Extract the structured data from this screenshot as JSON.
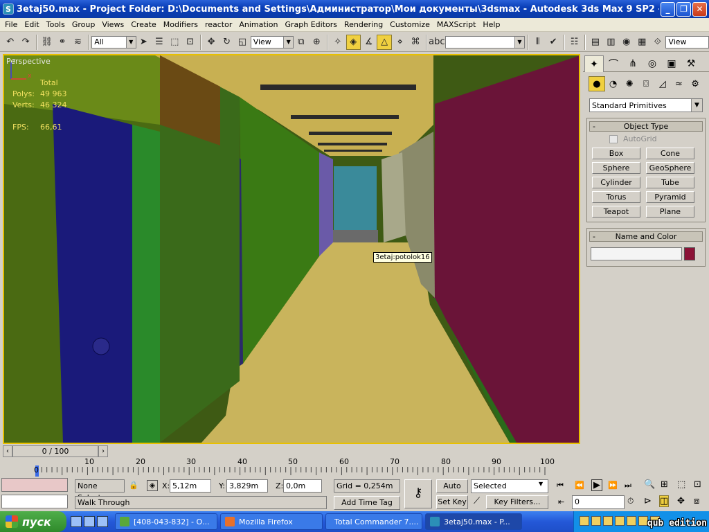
{
  "window": {
    "title": "3etaj50.max   - Project Folder: D:\\Documents and Settings\\Администратор\\Мои документы\\3dsmax   - Autodesk 3ds Max 9 SP2   - Display : ...",
    "app_icon": "S",
    "minimize": "_",
    "maximize": "❐",
    "close": "✕"
  },
  "menu": [
    "File",
    "Edit",
    "Tools",
    "Group",
    "Views",
    "Create",
    "Modifiers",
    "reactor",
    "Animation",
    "Graph Editors",
    "Rendering",
    "Customize",
    "MAXScript",
    "Help"
  ],
  "toolbar": {
    "selection_filter": "All",
    "reference_coord": "View",
    "named_selection": "",
    "right_view": "View"
  },
  "viewport": {
    "label": "Perspective",
    "stats_header": "Total",
    "polys_label": "Polys:",
    "polys_value": "49 963",
    "verts_label": "Verts:",
    "verts_value": "46 324",
    "fps_label": "FPS:",
    "fps_value": "66,61",
    "tooltip": "3etaj:potolok16",
    "axis_z": "z",
    "axis_x": "x",
    "colors": {
      "ceiling": "#c8b052",
      "floor": "#c9b45c",
      "left_wall": "#3a6a14",
      "right_wall": "#6a1438",
      "door": "#1a1a7a",
      "far_wall": "#3a8a9a"
    }
  },
  "command_panel": {
    "category": "Standard Primitives",
    "object_type_title": "Object Type",
    "autogrid": "AutoGrid",
    "primitives": [
      "Box",
      "Cone",
      "Sphere",
      "GeoSphere",
      "Cylinder",
      "Tube",
      "Torus",
      "Pyramid",
      "Teapot",
      "Plane"
    ],
    "name_color_title": "Name and Color",
    "object_color": "#8b1236"
  },
  "timeline": {
    "frame_display": "0 / 100",
    "ticks": [
      "0",
      "10",
      "20",
      "30",
      "40",
      "50",
      "60",
      "70",
      "80",
      "90",
      "100"
    ]
  },
  "status": {
    "selection": "None Selecte",
    "prompt": "Walk Through",
    "x_label": "X:",
    "x_value": "5,12m",
    "y_label": "Y:",
    "y_value": "3,829m",
    "z_label": "Z:",
    "z_value": "0,0m",
    "grid": "Grid = 0,254m",
    "add_time_tag": "Add Time Tag",
    "auto_key": "Auto Key",
    "set_key": "Set Key",
    "key_filter_select": "Selected",
    "key_filters": "Key Filters...",
    "current_frame": "0"
  },
  "taskbar": {
    "start": "пуск",
    "tasks": [
      {
        "label": "[408-043-832] - О...",
        "color": "#5aa83a"
      },
      {
        "label": "Mozilla Firefox",
        "color": "#e8702a"
      },
      {
        "label": "Total Commander 7....",
        "color": "#e8c02a"
      },
      {
        "label": "3etaj50.max    - P...",
        "color": "#2b8fb7"
      }
    ],
    "watermark": "qub edition"
  }
}
